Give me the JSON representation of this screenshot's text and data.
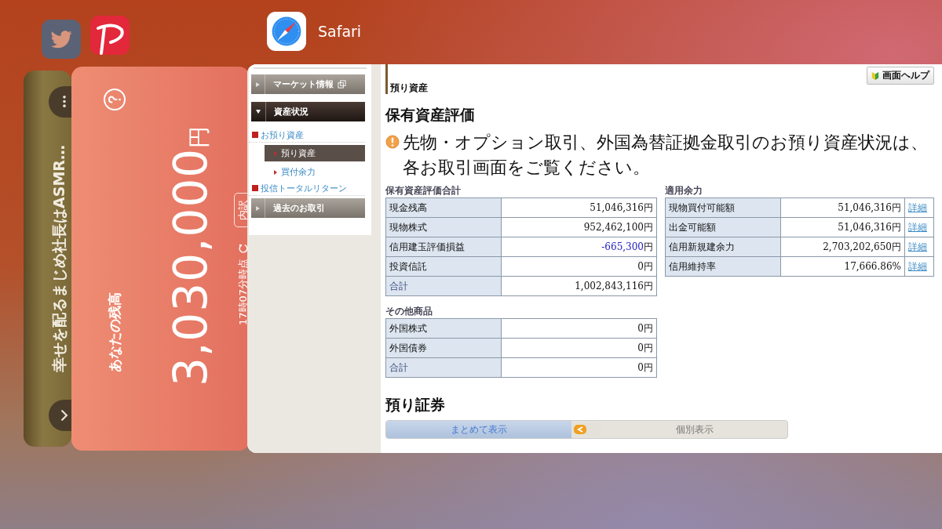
{
  "app_label": "Safari",
  "video_card": {
    "title": "幸せを配るまじめ社長はASMR…"
  },
  "wallet_card": {
    "balance_label": "あなたの残高",
    "balance": "3,030,000",
    "currency": "円",
    "breakdown_button": "内訳",
    "updated": "17時07分時点"
  },
  "browser": {
    "sidebar": {
      "items": [
        {
          "kind": "section",
          "label": "マーケット情報",
          "expanded": false,
          "external": true
        },
        {
          "kind": "section",
          "label": "資産状況",
          "expanded": true,
          "external": false
        },
        {
          "kind": "link",
          "label": "お預り資産"
        },
        {
          "kind": "sublink",
          "label": "預り資産",
          "selected": true
        },
        {
          "kind": "sublink",
          "label": "買付余力",
          "selected": false
        },
        {
          "kind": "link",
          "label": "投信トータルリターン"
        },
        {
          "kind": "section",
          "label": "過去のお取引",
          "expanded": false,
          "external": false
        }
      ]
    },
    "page": {
      "subtitle": "預り資産",
      "help_button": "画面ヘルプ",
      "heading": "保有資産評価",
      "notice": "先物・オプション取引、外国為替証拠金取引のお預り資産状況は、各お取引画面をご覧ください。",
      "left_tables": [
        {
          "caption": "保有資産評価合計",
          "rows": [
            {
              "kind": "item",
              "label": "現金残高",
              "amount": "51,046,316",
              "unit": "円",
              "negative": false
            },
            {
              "kind": "item",
              "label": "現物株式",
              "amount": "952,462,100",
              "unit": "円",
              "negative": false
            },
            {
              "kind": "item",
              "label": "信用建玉評価損益",
              "amount": "-665,300",
              "unit": "円",
              "negative": true
            },
            {
              "kind": "item",
              "label": "投資信託",
              "amount": "0",
              "unit": "円",
              "negative": false
            },
            {
              "kind": "total",
              "label": "合計",
              "amount": "1,002,843,116",
              "unit": "円",
              "negative": false
            }
          ]
        },
        {
          "caption": "その他商品",
          "rows": [
            {
              "kind": "item",
              "label": "外国株式",
              "amount": "0",
              "unit": "円",
              "negative": false
            },
            {
              "kind": "item",
              "label": "外国債券",
              "amount": "0",
              "unit": "円",
              "negative": false
            },
            {
              "kind": "total",
              "label": "合計",
              "amount": "0",
              "unit": "円",
              "negative": false
            }
          ]
        }
      ],
      "right_tables": [
        {
          "caption": "適用余力",
          "rows": [
            {
              "label": "現物買付可能額",
              "amount": "51,046,316",
              "unit": "円",
              "negative": false,
              "link": "詳細"
            },
            {
              "label": "出金可能額",
              "amount": "51,046,316",
              "unit": "円",
              "negative": false,
              "link": "詳細"
            },
            {
              "label": "信用新規建余力",
              "amount": "2,703,202,650",
              "unit": "円",
              "negative": false,
              "link": "詳細"
            },
            {
              "label": "信用維持率",
              "amount": "17,666.86",
              "unit": "%",
              "negative": false,
              "link": "詳細"
            }
          ]
        }
      ],
      "securities_heading": "預り証券",
      "view_toggle": [
        {
          "label": "まとめて表示",
          "selected": true
        },
        {
          "label": "個別表示",
          "selected": false
        }
      ]
    }
  }
}
